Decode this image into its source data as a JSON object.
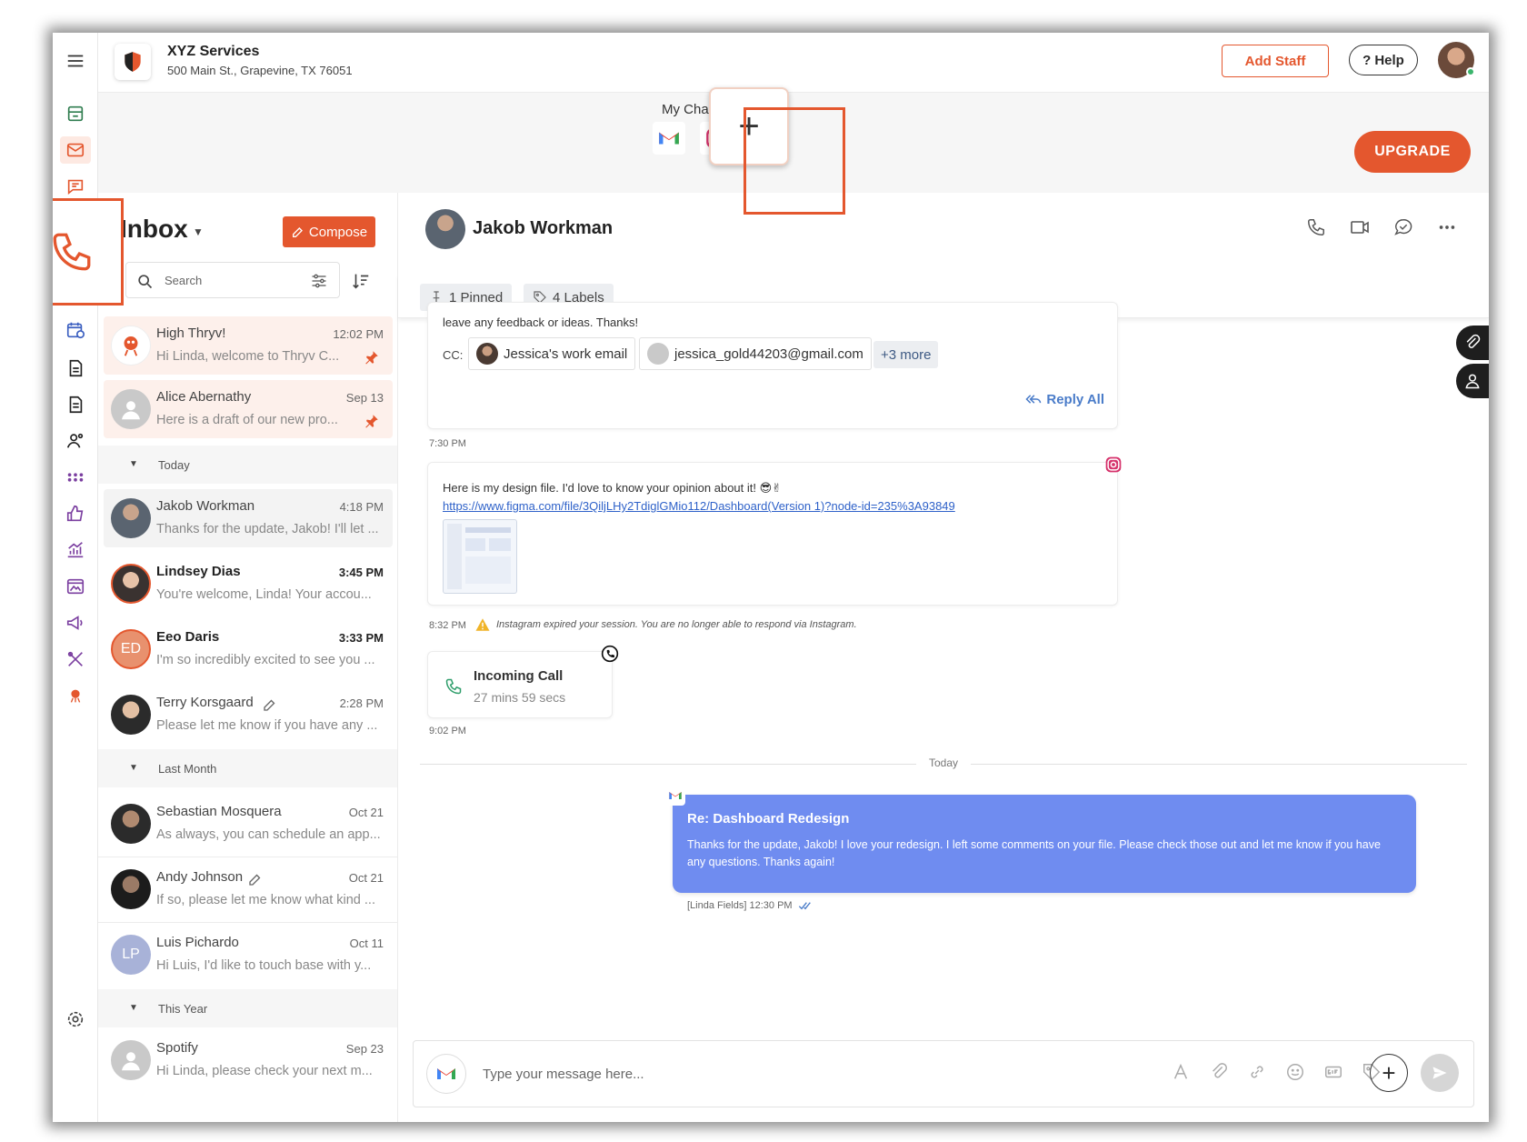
{
  "business": {
    "name": "XYZ Services",
    "address": "500 Main St., Grapevine, TX 76051"
  },
  "header": {
    "add_staff": "Add Staff",
    "help": "Help"
  },
  "channels": {
    "title": "My Channels (2/3)",
    "add": "+",
    "upgrade": "UPGRADE"
  },
  "inbox": {
    "title": "Inbox",
    "compose": "Compose",
    "search_placeholder": "Search",
    "sections": {
      "today": "Today",
      "last_month": "Last Month",
      "this_year": "This Year"
    },
    "pinned": [
      {
        "name": "High Thryv!",
        "time": "12:02 PM",
        "preview": "Hi Linda, welcome to Thryv C..."
      },
      {
        "name": "Alice Abernathy",
        "time": "Sep 13",
        "preview": "Here is a draft of our new pro..."
      }
    ],
    "today": [
      {
        "name": "Jakob Workman",
        "time": "4:18 PM",
        "preview": "Thanks for the update, Jakob! I'll let ..."
      },
      {
        "name": "Lindsey Dias",
        "time": "3:45 PM",
        "preview": "You're welcome, Linda! Your accou..."
      },
      {
        "name": "Eeo Daris",
        "initials": "ED",
        "time": "3:33 PM",
        "preview": "I'm so incredibly excited to see you ..."
      },
      {
        "name": "Terry Korsgaard",
        "time": "2:28 PM",
        "preview": "Please let me know if you have any ..."
      }
    ],
    "last_month": [
      {
        "name": "Sebastian Mosquera",
        "time": "Oct 21",
        "preview": "As always, you can schedule an app..."
      },
      {
        "name": "Andy Johnson",
        "time": "Oct 21",
        "preview": "If so, please let me know what kind ..."
      },
      {
        "name": "Luis Pichardo",
        "initials": "LP",
        "time": "Oct 11",
        "preview": "Hi Luis, I'd like to touch base with y..."
      }
    ],
    "this_year": [
      {
        "name": "Spotify",
        "time": "Sep 23",
        "preview": "Hi Linda, please check your next m..."
      }
    ]
  },
  "conversation": {
    "contact": "Jakob Workman",
    "pinned": "1 Pinned",
    "labels": "4 Labels",
    "email_tail": "leave any feedback or ideas. Thanks!",
    "cc_label": "CC:",
    "cc": [
      "Jessica's work email",
      "jessica_gold44203@gmail.com"
    ],
    "cc_more": "+3 more",
    "reply_all": "Reply All",
    "time1": "7:30 PM",
    "ig_message": "Here is my design file. I'd love to know your opinion about it! 😎✌",
    "ig_link": "https://www.figma.com/file/3QiljLHy2TdiglGMio112/Dashboard(Version 1)?node-id=235%3A93849",
    "time2": "8:32 PM",
    "ig_warning": "Instagram expired your session. You are no longer able to respond via Instagram.",
    "call_title": "Incoming Call",
    "call_duration": "27 mins 59 secs",
    "time3": "9:02 PM",
    "today": "Today",
    "sent_subject": "Re: Dashboard Redesign",
    "sent_body": "Thanks for the update, Jakob! I love your redesign. I left some comments on your file. Please check those out and let me know if you have any questions. Thanks again!",
    "sent_meta": "[Linda Fields] 12:30 PM",
    "composer_placeholder": "Type your message here..."
  },
  "colors": {
    "accent": "#e4572e",
    "bubble": "#6f8cf0",
    "link": "#2f62c9"
  }
}
